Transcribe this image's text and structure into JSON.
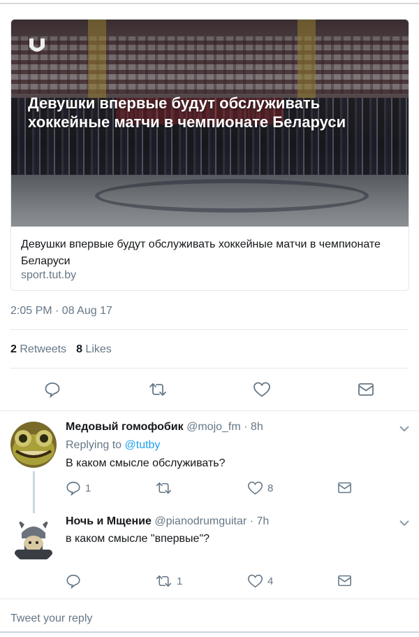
{
  "card": {
    "image_headline": "Девушки впервые будут обслуживать хоккейные матчи в чемпионате Беларуси",
    "logo_icon": "tutby-logo-icon",
    "title": "Девушки впервые будут обслуживать хоккейные матчи в чемпионате Беларуси",
    "domain": "sport.tut.by"
  },
  "tweet": {
    "timestamp": "2:05 PM · 08 Aug 17",
    "retweets_count": "2",
    "retweets_label": "Retweets",
    "likes_count": "8",
    "likes_label": "Likes",
    "actions": {
      "reply_icon": "reply-icon",
      "retweet_icon": "retweet-icon",
      "like_icon": "heart-icon",
      "dm_icon": "envelope-icon"
    }
  },
  "replies": [
    {
      "name": "Медовый гомофобик",
      "handle": "@mojo_fm",
      "time": "· 8h",
      "replying_prefix": "Replying to",
      "replying_to": "@tutby",
      "text": "В каком смысле обслуживать?",
      "reply_count": "1",
      "retweet_count": "",
      "like_count": "8"
    },
    {
      "name": "Ночь и Мщение",
      "handle": "@pianodrumguitar",
      "time": "· 7h",
      "text": "в каком смысле \"впервые\"?",
      "reply_count": "",
      "retweet_count": "1",
      "like_count": "4"
    }
  ],
  "composer": {
    "placeholder": "Tweet your reply"
  },
  "colors": {
    "accent": "#1da1f2",
    "muted": "#657786",
    "text": "#14171a",
    "border": "#e1e8ed"
  }
}
